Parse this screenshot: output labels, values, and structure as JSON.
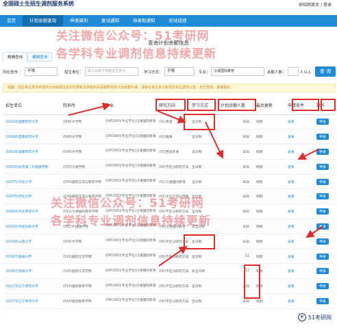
{
  "header": {
    "logo_text": "全国硕士生招生调剂服务系统",
    "links": "研招网首页 | 登录"
  },
  "nav": {
    "items": [
      {
        "label": "首页",
        "active": false
      },
      {
        "label": "计划余额查询",
        "active": true
      },
      {
        "label": "申请调剂",
        "active": false
      },
      {
        "label": "复试通知",
        "active": false
      },
      {
        "label": "待录取通知",
        "active": false
      },
      {
        "label": "初试成绩",
        "active": false
      }
    ]
  },
  "page_title": "查询计划余额信息",
  "tabs": [
    {
      "label": "精确查询",
      "active": true
    },
    {
      "label": "模糊查询",
      "active": false
    }
  ],
  "filters": {
    "region_label": "所在省市：",
    "region_value": "不限",
    "school_label": "招生单位：",
    "school_placeholder": "输入关键字搜索招生单位",
    "mode_label": "学习方式：",
    "mode_value": "不限",
    "major_label": "专业：",
    "major_value": "汉语国际教育",
    "remaining_label": "余额人数：",
    "remaining_unit": "人以上",
    "search_label": "查 询"
  },
  "notice": "提醒：招生单位发布的调剂计划余额信息实时更新及更新时间请按照实际计划余额为准，请各位考生关注各招生单位调剂公告，自行查询，谨慎报名。",
  "table": {
    "headers": [
      "招生单位",
      "院系所",
      "专业",
      "研究方向",
      "学习方式",
      "计划余额人数",
      "最后更新",
      "申请条件",
      "操作"
    ],
    "rows": [
      {
        "school": "(10028)首都师范大学",
        "dept": "(008)文学院",
        "major": "(045300)(专业学位)汉语国际教育",
        "direction": "(01)英语",
        "mode": "全日制",
        "remaining": "未知",
        "updated": "刚刚",
        "cond": "查看",
        "action": "申请"
      },
      {
        "school": "(10028)首都师范大学",
        "dept": "(008)文学院",
        "major": "(045300)(专业学位)汉语国际教育",
        "direction": "(02)俄语",
        "mode": "全日制",
        "remaining": "未知",
        "updated": "刚刚",
        "cond": "查看",
        "action": "申请"
      },
      {
        "school": "(10028)首都师范大学",
        "dept": "(008)文学院",
        "major": "(045300)(专业学位)汉语国际教育",
        "direction": "(03)西班牙语",
        "mode": "全日制",
        "remaining": "未知",
        "updated": "刚刚",
        "cond": "查看",
        "action": "申请"
      },
      {
        "school": "(10030)北京第二外国语学院",
        "dept": "(015)汉语学院",
        "major": "(045300)(专业学位)汉语国际教育",
        "direction": "(00)不区分研究方向",
        "mode": "全日制",
        "remaining": "未知",
        "updated": "刚刚",
        "cond": "查看",
        "action": "申请"
      },
      {
        "school": "(10075)河北大学",
        "dept": "(030)国际交流与教育学院",
        "major": "(045300)(专业学位)汉语国际教育",
        "direction": "(01)汉语国际教育",
        "mode": "全日制",
        "remaining": "未知",
        "updated": "刚刚",
        "cond": "查看",
        "action": "申请"
      },
      {
        "school": "(10075)河北大学",
        "dept": "(030)国际交流与教育学院",
        "major": "(045300)(专业学位)汉语国际教育",
        "direction": "(02)文化交流与传播",
        "mode": "全日制",
        "remaining": "未知",
        "updated": "刚刚",
        "cond": "查看",
        "action": "申请"
      },
      {
        "school": "(10094)河北师范大学",
        "dept": "(012)汉语国际教育学院",
        "major": "(045300)(专业学位)汉语国际教育",
        "direction": "(00)不区分研究方向",
        "mode": "全日制",
        "remaining": "未知",
        "updated": "刚刚",
        "cond": "查看",
        "action": "申请"
      },
      {
        "school": "(10100)河北科技大学",
        "dept": "(012)外国语学院",
        "major": "(045300)(专业学位)汉语国际教育",
        "direction": "(00)汉语国际教育",
        "mode": "非全日制",
        "remaining": "未知",
        "updated": "刚刚",
        "cond": "查看",
        "action": "申请"
      },
      {
        "school": "(10108)山西大学",
        "dept": "(008)文学院",
        "major": "(045300)(专业学位)汉语国际教育",
        "direction": "(00)不区分研究方向",
        "mode": "全日制",
        "remaining": "未知",
        "updated": "刚刚",
        "cond": "查看",
        "action": "申请"
      },
      {
        "school": "(10167)渤海大学",
        "dept": "(016)国际交流学院",
        "major": "(045300)(专业学位)汉语国际教育",
        "direction": "(00)不区分研究方向",
        "mode": "全日制",
        "remaining": "31",
        "updated": "刚刚",
        "cond": "查看",
        "action": "申请"
      },
      {
        "school": "(10167)渤海大学",
        "dept": "(016)国际交流学院",
        "major": "(045300)(专业学位)汉语国际教育",
        "direction": "(00)不区分研究方向",
        "mode": "非全日制",
        "remaining": "12",
        "updated": "刚刚",
        "cond": "查看",
        "action": "申请"
      },
      {
        "school": "(10173)辽宁师范大学",
        "dept": "(014)国际教育学院",
        "major": "(045300)(专业学位)汉语国际教育",
        "direction": "(00)不区分研究方向",
        "mode": "全日制",
        "remaining": "未知",
        "updated": "刚刚",
        "cond": "查看",
        "action": "申请"
      },
      {
        "school": "(10173)辽宁师范大学",
        "dept": "(014)国际教育学院",
        "major": "(045300)(专业学位)汉语国际教育",
        "direction": "(00)不区分研究方向",
        "mode": "全日制",
        "remaining": "未知",
        "updated": "刚刚",
        "cond": "查看",
        "action": "申请"
      }
    ]
  },
  "watermark": {
    "line1": "关注微信公众号：51考研网",
    "line2": "各学科专业调剂信息持续更新",
    "line3": "关注微信公众号：51考研网",
    "line4": "各学科专业调剂信息持续更新"
  },
  "badge": "51考研网",
  "colors": {
    "primary": "#1f8bd6",
    "highlight": "#e02b2b",
    "watermark": "#e43c3c"
  }
}
